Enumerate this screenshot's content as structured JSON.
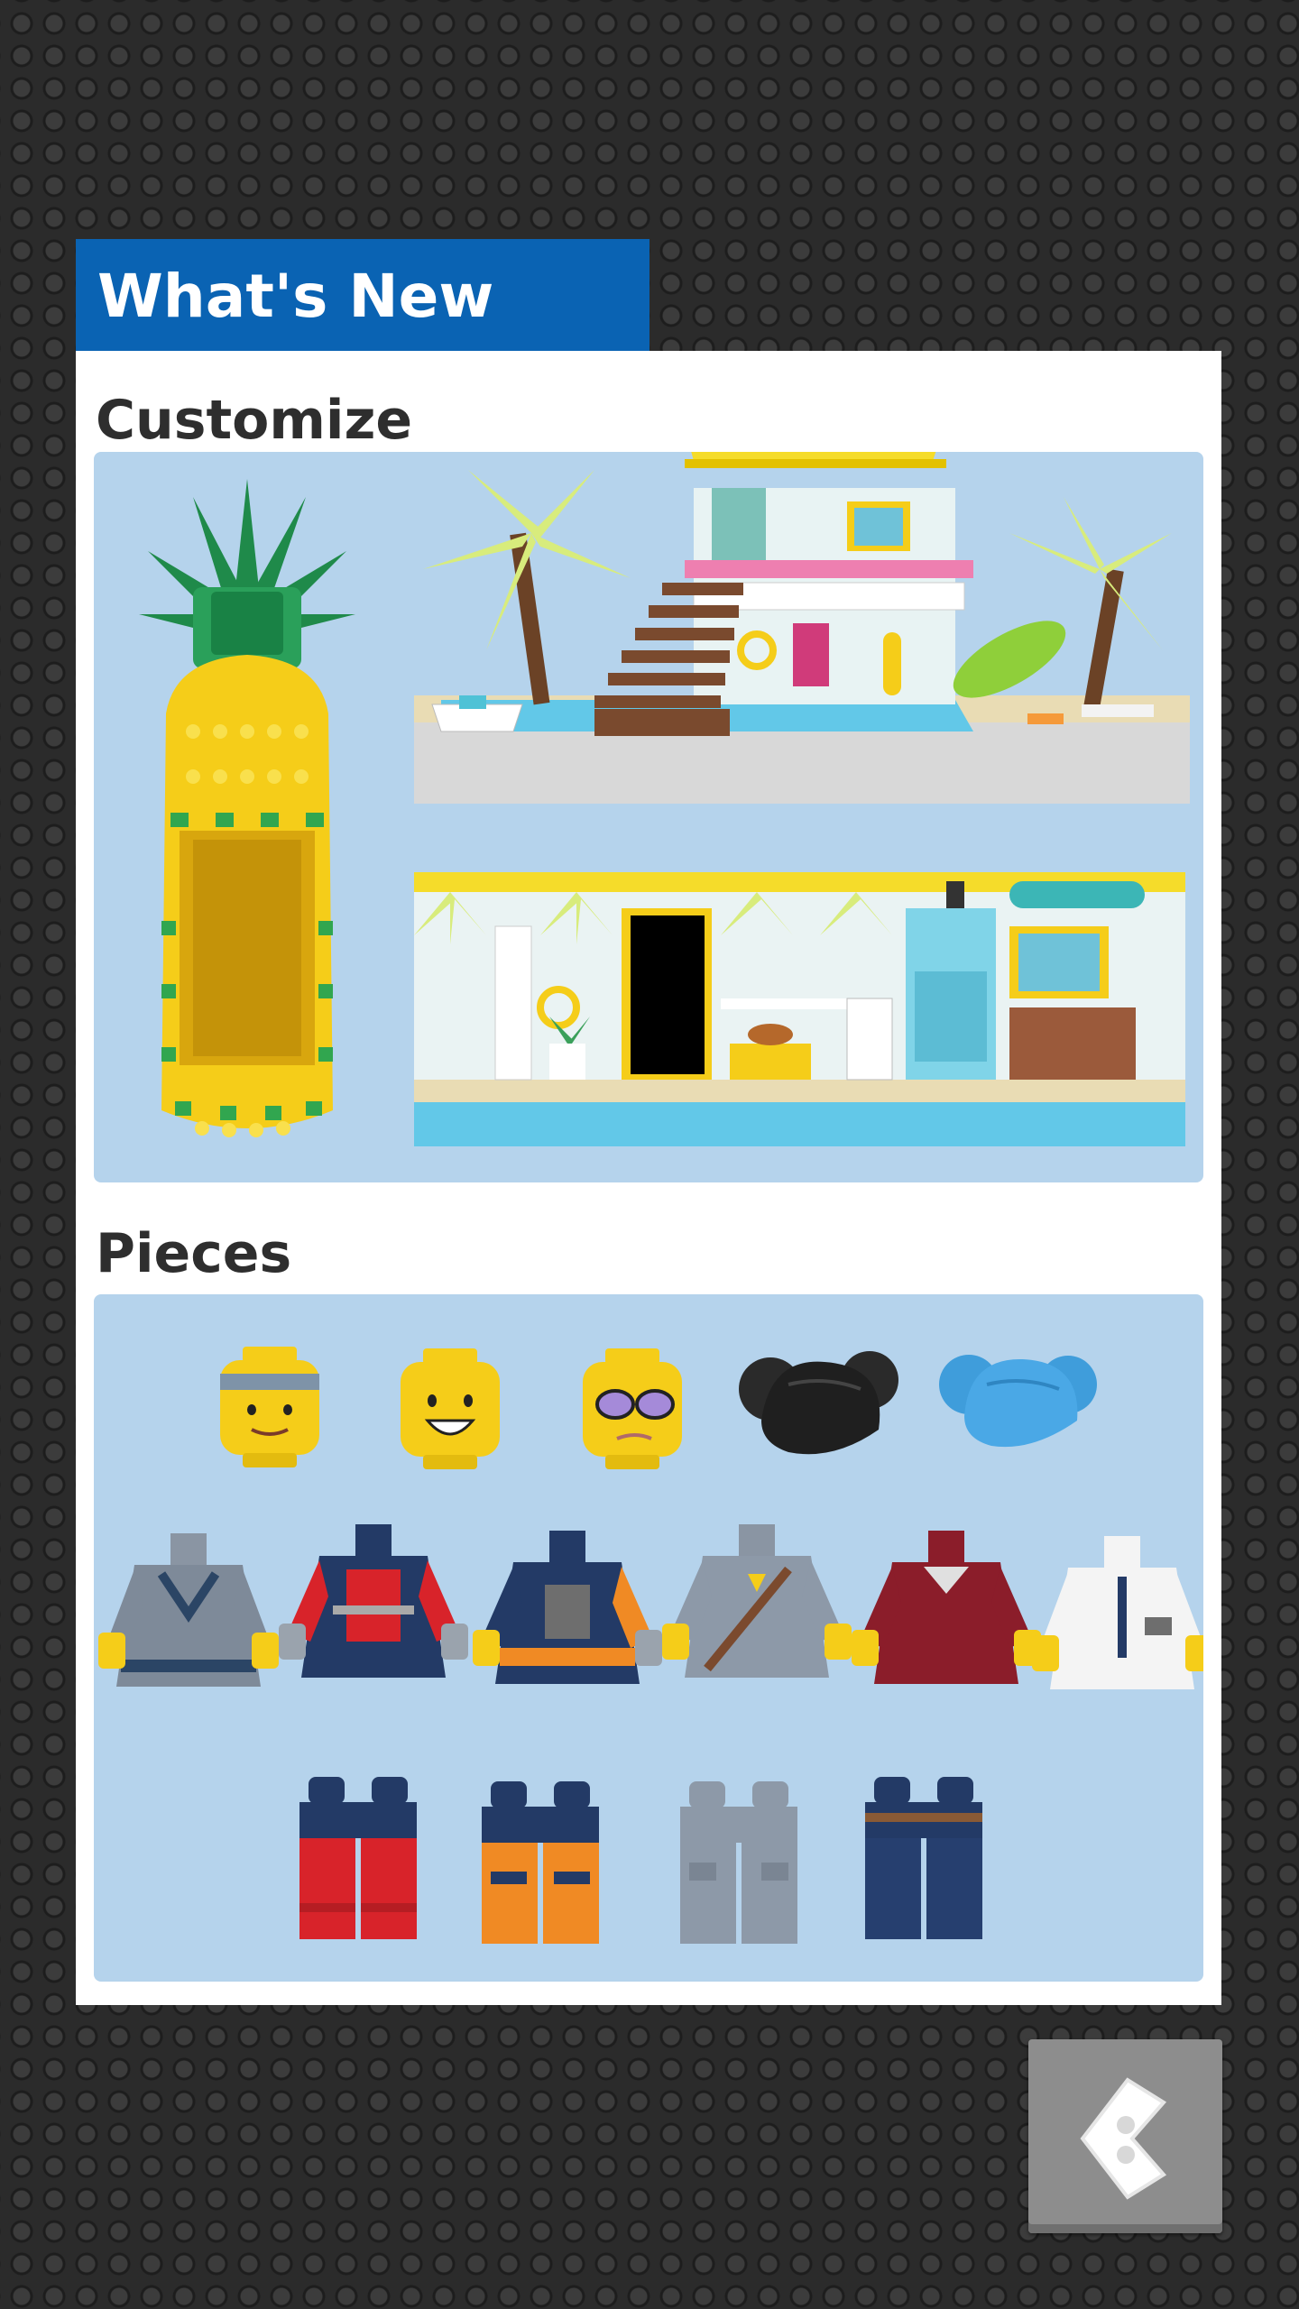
{
  "header": {
    "title": "What's New"
  },
  "sections": {
    "customize": {
      "title": "Customize"
    },
    "pieces": {
      "title": "Pieces"
    }
  },
  "pieces": {
    "heads": [
      "headband-head-icon",
      "smiling-head-icon",
      "glasses-head-icon",
      "black-hair-buns-icon",
      "blue-hair-buns-icon"
    ],
    "torsos": [
      "grey-harness-torso-icon",
      "red-rescue-torso-icon",
      "navy-orange-torso-icon",
      "grey-satchel-torso-icon",
      "maroon-hoodie-torso-icon",
      "white-pilot-torso-icon"
    ],
    "legs": [
      "red-navy-legs-icon",
      "orange-navy-legs-icon",
      "grey-legs-icon",
      "navy-belt-legs-icon"
    ]
  },
  "colors": {
    "accent": "#0a63b3",
    "card_bg": "#b5d3ec",
    "lego_yellow": "#f5cd19"
  },
  "navigation": {
    "back_icon": "back-arrow-brick-icon"
  }
}
